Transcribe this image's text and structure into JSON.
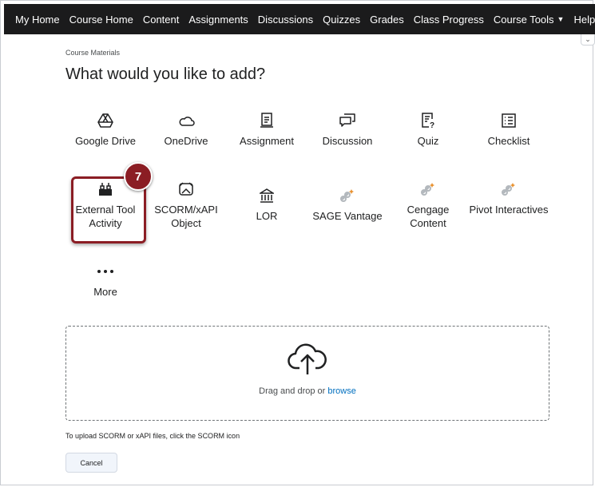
{
  "nav": {
    "items": [
      {
        "label": "My Home"
      },
      {
        "label": "Course Home"
      },
      {
        "label": "Content"
      },
      {
        "label": "Assignments"
      },
      {
        "label": "Discussions"
      },
      {
        "label": "Quizzes"
      },
      {
        "label": "Grades"
      },
      {
        "label": "Class Progress"
      },
      {
        "label": "Course Tools",
        "dropdown": true
      },
      {
        "label": "Help",
        "dropdown": true
      }
    ]
  },
  "breadcrumb": "Course Materials",
  "title": "What would you like to add?",
  "tiles": [
    {
      "label": "Google Drive",
      "icon": "google-drive-icon"
    },
    {
      "label": "OneDrive",
      "icon": "onedrive-icon"
    },
    {
      "label": "Assignment",
      "icon": "assignment-icon"
    },
    {
      "label": "Discussion",
      "icon": "discussion-icon"
    },
    {
      "label": "Quiz",
      "icon": "quiz-icon"
    },
    {
      "label": "Checklist",
      "icon": "checklist-icon"
    },
    {
      "label": "External Tool Activity",
      "icon": "external-tool-icon"
    },
    {
      "label": "SCORM/xAPI Object",
      "icon": "scorm-icon"
    },
    {
      "label": "LOR",
      "icon": "lor-icon"
    },
    {
      "label": "SAGE Vantage",
      "icon": "link-icon"
    },
    {
      "label": "Cengage Content",
      "icon": "link-icon"
    },
    {
      "label": "Pivot Interactives",
      "icon": "link-icon"
    },
    {
      "label": "More",
      "icon": "more-icon"
    }
  ],
  "step_badge": "7",
  "dropzone": {
    "text": "Drag and drop or",
    "link": "browse"
  },
  "help_text": "To upload SCORM or xAPI files, click the SCORM icon",
  "cancel_label": "Cancel",
  "colors": {
    "accent": "#8b1d24",
    "nav_bg": "#1b1b1c",
    "link": "#006fbf"
  }
}
